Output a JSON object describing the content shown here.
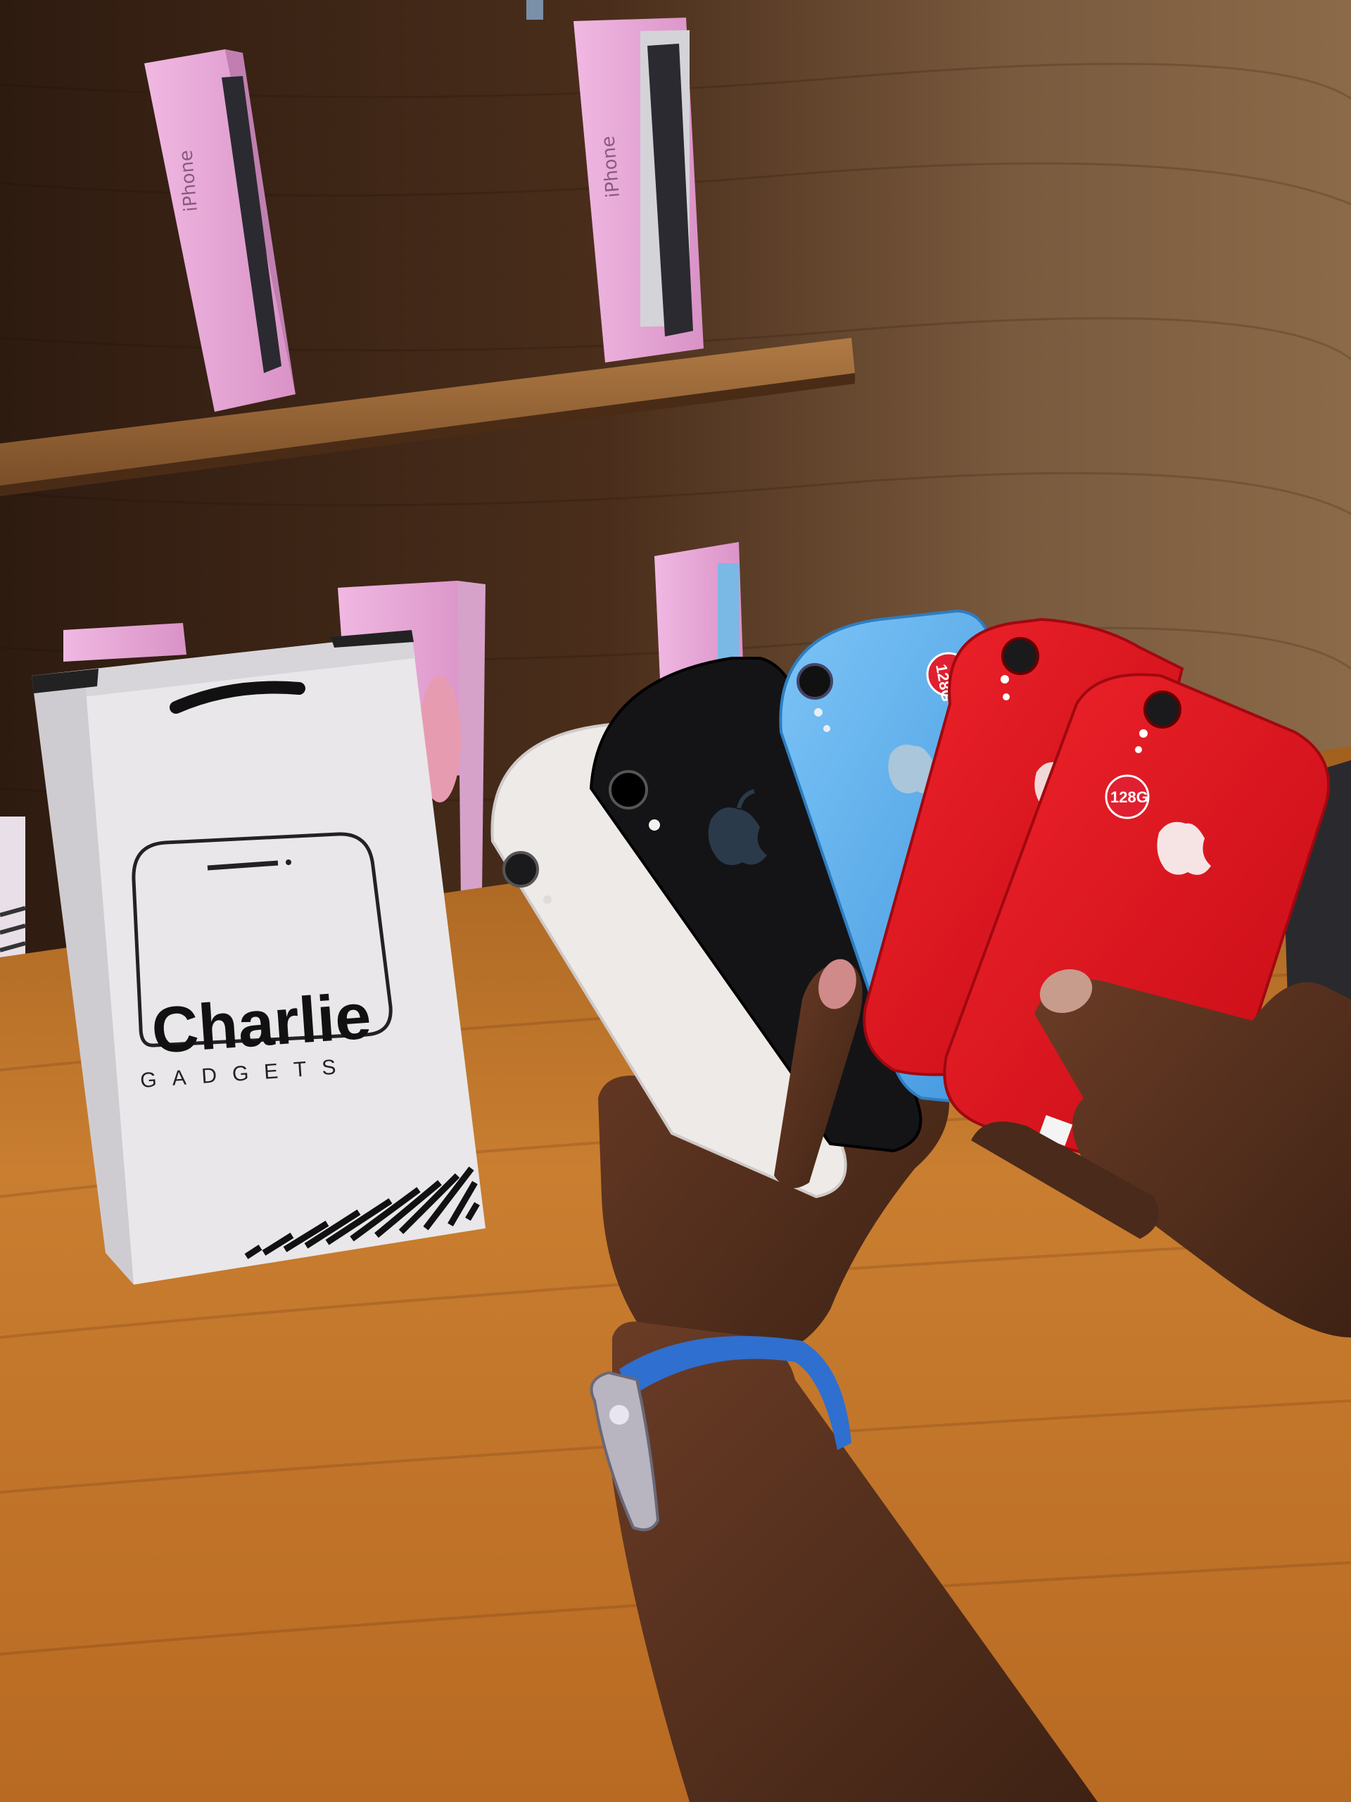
{
  "scene": {
    "bag": {
      "brand_name": "Charlie",
      "brand_subtitle": "GADGETS"
    },
    "boxes": {
      "label": "iPhone"
    },
    "phones": [
      {
        "color_name": "white",
        "color": "#eeeae8",
        "sticker": ""
      },
      {
        "color_name": "black",
        "color": "#141416",
        "sticker": ""
      },
      {
        "color_name": "blue",
        "color": "#5aacec",
        "sticker": "128G"
      },
      {
        "color_name": "red",
        "color": "#e0101c",
        "sticker": ""
      },
      {
        "color_name": "red",
        "color": "#e4121e",
        "sticker": "128G"
      }
    ],
    "palette": {
      "wall_dark": "#3b2415",
      "wall_light": "#6b4a30",
      "shelf": "#9a6a3c",
      "table": "#c4782a",
      "bag": "#e9e7ea",
      "box_pink": "#e8a6d6",
      "skin": "#5a3220",
      "watch_strap": "#2f6fd0"
    }
  }
}
